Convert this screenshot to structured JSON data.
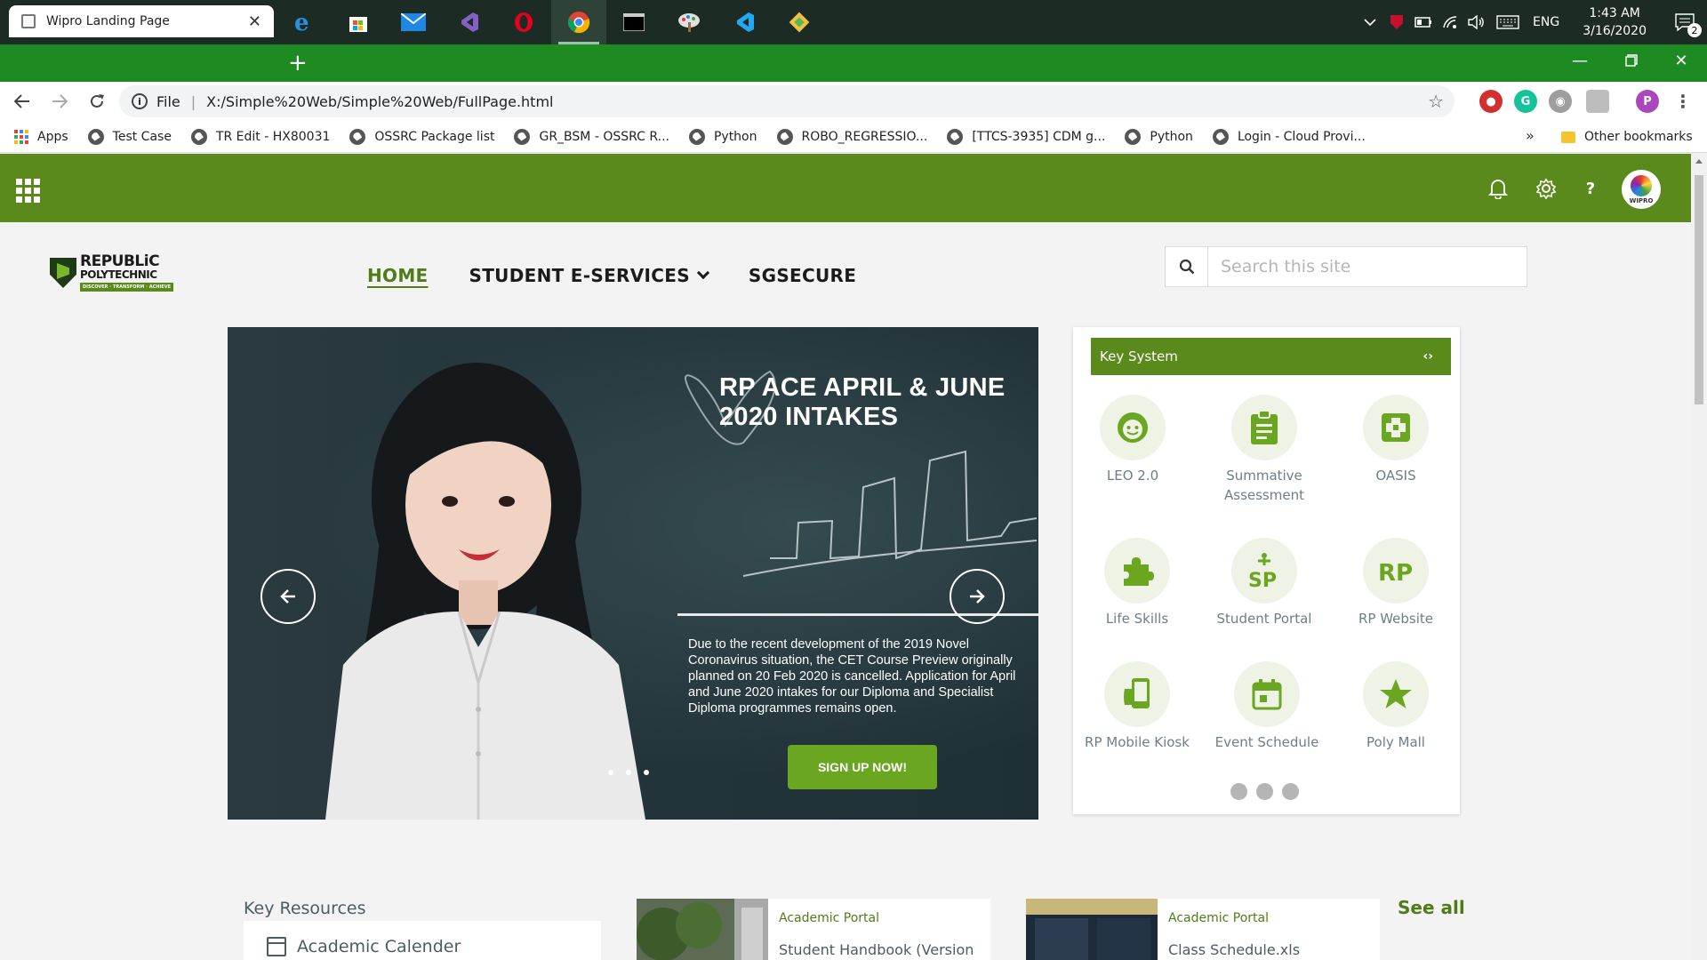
{
  "taskbar": {
    "apps": [
      "start-icon",
      "search-icon",
      "cortana-icon",
      "task-view-icon",
      "file-explorer-icon",
      "edge-icon",
      "store-icon",
      "mail-icon",
      "visual-studio-icon",
      "opera-icon",
      "chrome-icon",
      "terminal-icon",
      "paint-icon",
      "vscode-icon",
      "git-icon"
    ],
    "language": "ENG",
    "time": "1:43 AM",
    "date": "3/16/2020",
    "notification_count": "2"
  },
  "browser": {
    "tab_title": "Wipro Landing Page",
    "url_scheme": "File",
    "url": "X:/Simple%20Web/Simple%20Web/FullPage.html",
    "tabstrip_color": "#1e8a22",
    "bookmarks": [
      {
        "label": "Apps"
      },
      {
        "label": "Test Case"
      },
      {
        "label": "TR Edit - HX80031"
      },
      {
        "label": "OSSRC Package list"
      },
      {
        "label": "GR_BSM - OSSRC R..."
      },
      {
        "label": "Python"
      },
      {
        "label": "ROBO_REGRESSIO..."
      },
      {
        "label": "[TTCS-3935] CDM g..."
      },
      {
        "label": "Python"
      },
      {
        "label": "Login - Cloud Provi..."
      }
    ],
    "more_bookmarks": "»",
    "other_bookmarks": "Other bookmarks"
  },
  "site": {
    "accent": "#5b8a1c",
    "avatar_label": "WIPRO",
    "logo": {
      "line1": "REPUBLiC",
      "line2": "POLYTECHNIC",
      "tagline": "DISCOVER · TRANSFORM · ACHIEVE"
    },
    "nav": {
      "home": "HOME",
      "services": "STUDENT E-SERVICES",
      "sgsecure": "SGSECURE"
    },
    "search": {
      "placeholder": "Search this site"
    },
    "hero": {
      "title": "RP ACE APRIL & JUNE 2020 INTAKES",
      "body": "Due to the recent development of the 2019 Novel Coronavirus situation, the CET Course Preview originally planned on 20 Feb 2020 is cancelled. Application for April and June 2020 intakes for our Diploma and Specialist Diploma programmes remains open.",
      "cta": "SIGN UP NOW!"
    },
    "key_system": {
      "title": "Key System",
      "control": "‹›",
      "items": [
        {
          "label": "LEO 2.0",
          "icon": "smiley-icon"
        },
        {
          "label": "Summative Assessment",
          "icon": "clipboard-icon"
        },
        {
          "label": "OASIS",
          "icon": "cross-puzzle-icon"
        },
        {
          "label": "Life Skills",
          "icon": "puzzle-icon"
        },
        {
          "label": "Student Portal",
          "icon": "sp-icon"
        },
        {
          "label": "RP Website",
          "icon": "rp-icon"
        },
        {
          "label": "RP Mobile Kiosk",
          "icon": "mobile-icon"
        },
        {
          "label": "Event Schedule",
          "icon": "calendar-icon"
        },
        {
          "label": "Poly Mall",
          "icon": "star-icon"
        }
      ],
      "page_count": 3
    },
    "key_resources": {
      "title": "Key Resources",
      "items": [
        {
          "label": "Academic Calender"
        }
      ]
    },
    "documents": [
      {
        "category": "Academic Portal",
        "name": "Student Handbook (Version"
      },
      {
        "category": "Academic Portal",
        "name": "Class Schedule.xls"
      }
    ],
    "see_all": "See all"
  }
}
